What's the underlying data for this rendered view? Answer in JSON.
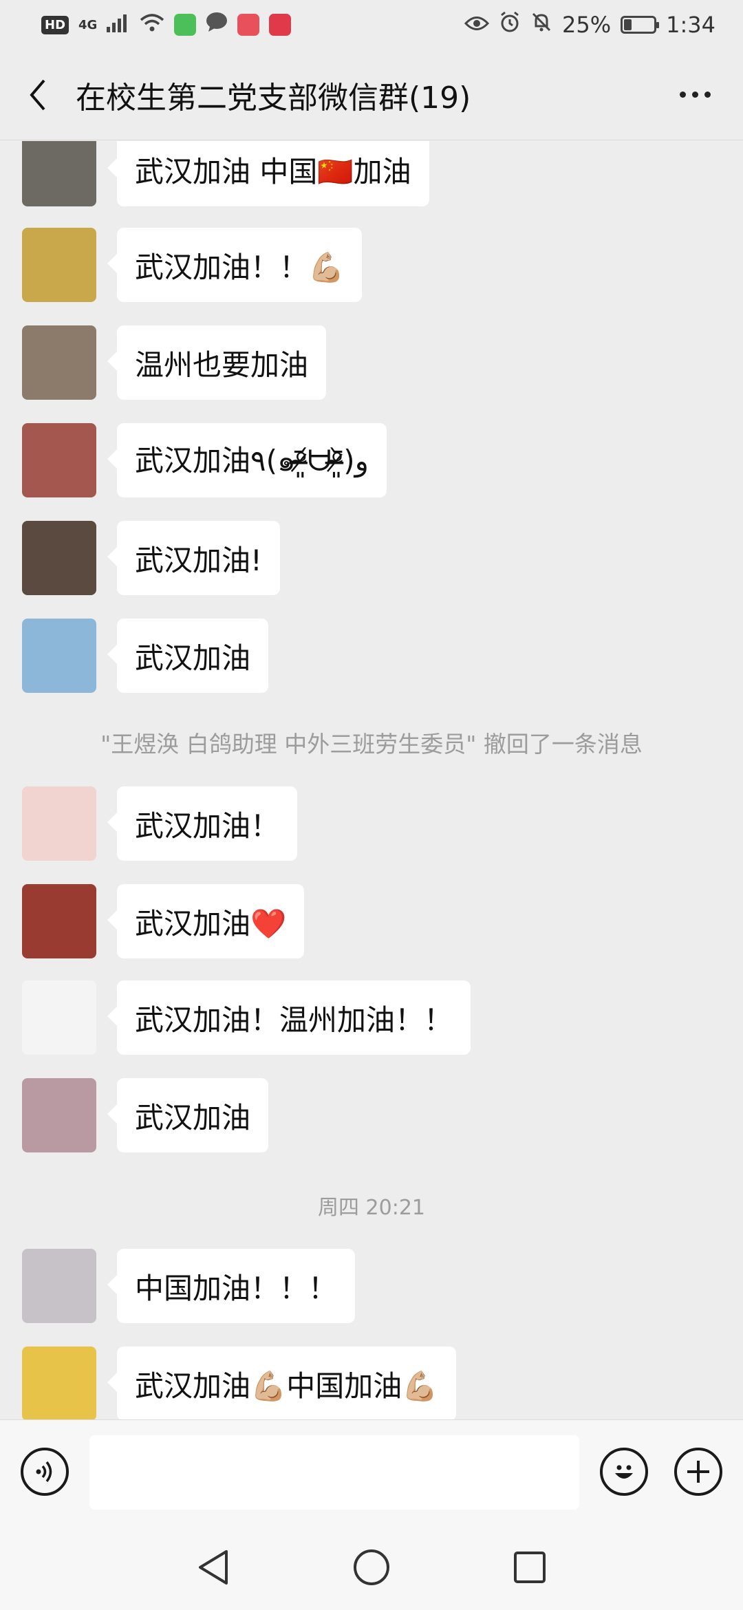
{
  "status_bar": {
    "hd": "HD",
    "network": "4G",
    "battery_text": "25%",
    "battery_level": 0.25,
    "time": "1:34"
  },
  "header": {
    "title": "在校生第二党支部微信群(19)"
  },
  "messages": [
    {
      "text": "武汉加油 中国🇨🇳加油",
      "avatar_color": "#6d6a63"
    },
    {
      "text": "武汉加油！！💪🏼",
      "avatar_color": "#c9a84c"
    },
    {
      "text": "温州也要加油",
      "avatar_color": "#8c7b6a"
    },
    {
      "text": "武汉加油٩(๑ᵒ̴̶̷͈᷄ᗨᵒ̴̶̷͈᷅)و",
      "avatar_color": "#a4574f"
    },
    {
      "text": "武汉加油!",
      "avatar_color": "#5a4a3f"
    },
    {
      "text": "武汉加油",
      "avatar_color": "#8db7d9"
    },
    {
      "text": "武汉加油！",
      "avatar_color": "#f1d3cf"
    },
    {
      "text": "武汉加油❤️",
      "avatar_color": "#9a3b32"
    },
    {
      "text": "武汉加油！温州加油！！",
      "avatar_color": "#f4f4f4"
    },
    {
      "text": "武汉加油",
      "avatar_color": "#b99aa3"
    },
    {
      "text": "中国加油！！！",
      "avatar_color": "#c7c2c8"
    },
    {
      "text": "武汉加油💪🏼中国加油💪🏼",
      "avatar_color": "#e8c34a"
    }
  ],
  "system_notice": "\"王煜涣 白鸽助理 中外三班劳生委员\" 撤回了一条消息",
  "timestamp": "周四 20:21",
  "colors": {
    "background": "#ededed",
    "bubble": "#ffffff",
    "system_text": "#9c9c9c"
  }
}
